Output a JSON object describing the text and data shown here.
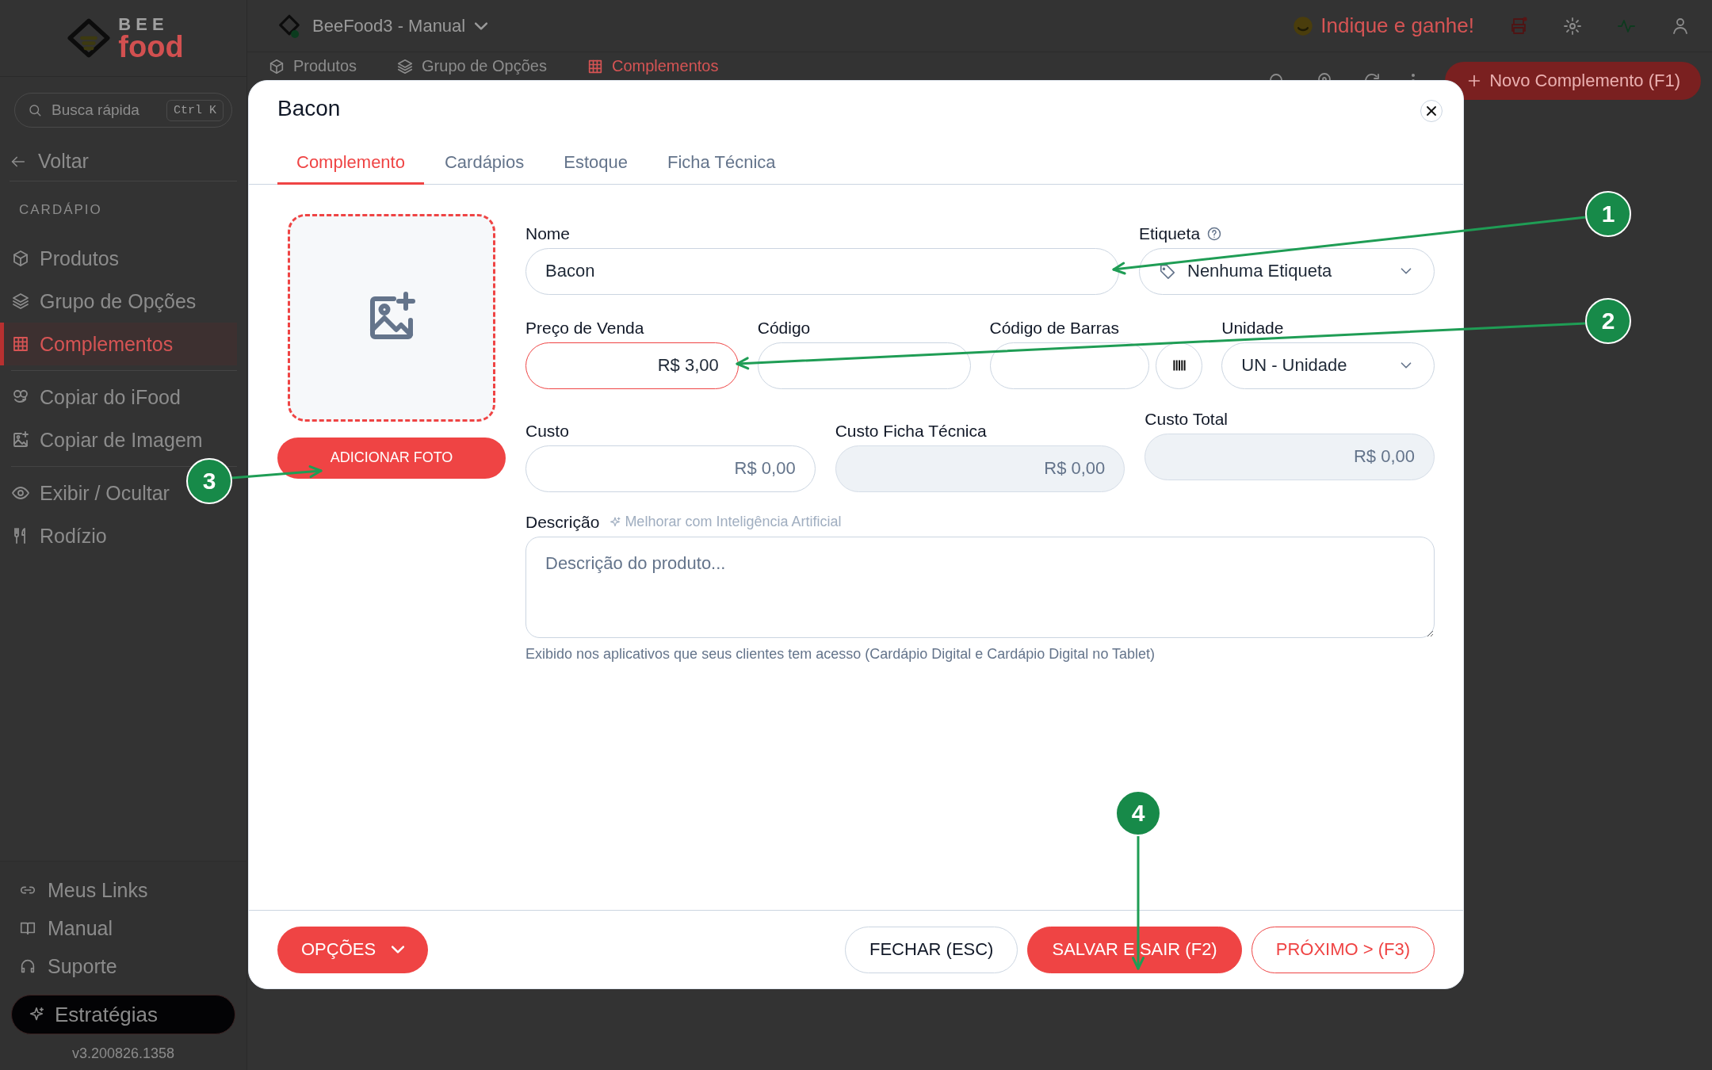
{
  "brand": {
    "top": "BEE",
    "bottom": "food"
  },
  "sidebar": {
    "search": {
      "placeholder": "Busca rápida",
      "shortcut": "Ctrl K"
    },
    "back": "Voltar",
    "section": "CARDÁPIO",
    "groups": [
      {
        "items": [
          {
            "label": "Produtos",
            "selected": false
          },
          {
            "label": "Grupo de Opções",
            "selected": false
          },
          {
            "label": "Complementos",
            "selected": true
          }
        ]
      },
      {
        "items": [
          {
            "label": "Copiar do iFood",
            "selected": false
          },
          {
            "label": "Copiar de Imagem",
            "selected": false
          }
        ]
      },
      {
        "items": [
          {
            "label": "Exibir / Ocultar",
            "selected": false
          },
          {
            "label": "Rodízio",
            "selected": false
          }
        ]
      }
    ],
    "footer_links": [
      "Meus Links",
      "Manual",
      "Suporte"
    ],
    "strategy_button": "Estratégias",
    "version": "v3.200826.1358"
  },
  "topbar": {
    "workspace": "BeeFood3 - Manual",
    "referral": "Indique e ganhe!"
  },
  "page_tabs": [
    {
      "label": "Produtos",
      "selected": false
    },
    {
      "label": "Grupo de Opções",
      "selected": false
    },
    {
      "label": "Complementos",
      "selected": true
    }
  ],
  "new_button": "Novo Complemento (F1)",
  "modal": {
    "title": "Bacon",
    "tabs": [
      {
        "label": "Complemento",
        "selected": true
      },
      {
        "label": "Cardápios",
        "selected": false
      },
      {
        "label": "Estoque",
        "selected": false
      },
      {
        "label": "Ficha Técnica",
        "selected": false
      }
    ],
    "photo_button": "ADICIONAR FOTO",
    "name": {
      "label": "Nome",
      "value": "Bacon"
    },
    "tag": {
      "label": "Etiqueta",
      "value": "Nenhuma Etiqueta"
    },
    "price": {
      "label": "Preço de Venda",
      "value": "R$ 3,00",
      "focused": true
    },
    "code": {
      "label": "Código"
    },
    "barcode": {
      "label": "Código de Barras"
    },
    "unit": {
      "label": "Unidade",
      "value": "UN - Unidade"
    },
    "costs": [
      {
        "label": "Custo",
        "value": "R$ 0,00",
        "disabled": false
      },
      {
        "label": "Custo Ficha Técnica",
        "value": "R$ 0,00",
        "disabled": true
      },
      {
        "label": "Custo Total",
        "value": "R$ 0,00",
        "disabled": true
      }
    ],
    "description": {
      "label": "Descrição",
      "ai_link": "Melhorar com Inteligência Artificial",
      "placeholder": "Descrição do produto...",
      "hint": "Exibido nos aplicativos que seus clientes tem acesso (Cardápio Digital e Cardápio Digital no Tablet)"
    },
    "options_button": "OPÇÕES",
    "buttons": [
      {
        "label": "FECHAR (ESC)",
        "kind": "outline"
      },
      {
        "label": "SALVAR E SAIR (F2)",
        "kind": "primary"
      },
      {
        "label": "PRÓXIMO > (F3)",
        "kind": "danger"
      }
    ]
  },
  "annotations": [
    {
      "number": "1"
    },
    {
      "number": "2"
    },
    {
      "number": "3"
    },
    {
      "number": "4"
    }
  ]
}
